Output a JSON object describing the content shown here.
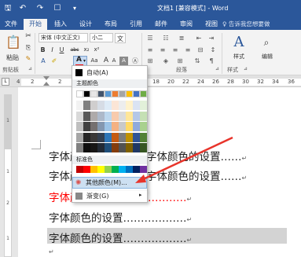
{
  "title_bar": {
    "doc_title": "文档1 [兼容模式] - Word",
    "qa_icons": [
      "save-icon",
      "undo-icon",
      "redo-icon",
      "touch-icon",
      "customize-icon"
    ],
    "window_buttons": [
      "ribbon-options-icon",
      "minimize-icon",
      "restore-icon",
      "close-icon"
    ],
    "qa_glyphs": [
      "🖫",
      "↶",
      "↷",
      "☐",
      "▾"
    ],
    "win_glyphs": [
      "⊡",
      "—",
      "❐",
      "✕"
    ]
  },
  "tabs": [
    {
      "label": "文件"
    },
    {
      "label": "开始",
      "active": true
    },
    {
      "label": "插入"
    },
    {
      "label": "设计"
    },
    {
      "label": "布局"
    },
    {
      "label": "引用"
    },
    {
      "label": "邮件"
    },
    {
      "label": "审阅"
    },
    {
      "label": "视图"
    }
  ],
  "tell_me": "♀ 告诉我您想要做",
  "ribbon": {
    "paste_label": "粘贴",
    "clipboard_label": "剪贴板",
    "font_name": "宋体 (中文正文)",
    "font_size": "小二",
    "wen_btn": "文",
    "bold": "B",
    "italic": "I",
    "underline": "U",
    "strike": "abc",
    "sub": "x₂",
    "sup": "x²",
    "font_color_btn": "A",
    "aa_btn": "Aa",
    "grow": "A",
    "shrink": "A",
    "clear_btn": "A",
    "style_label": "样式",
    "edit_label": "编辑",
    "paragraph_label": "段落",
    "styles_group_label": "样式",
    "corner_mark": "⊿"
  },
  "ruler": {
    "ticks": [
      "4",
      "2",
      "2",
      "18",
      "20",
      "22",
      "24",
      "26",
      "28",
      "30",
      "32",
      "34",
      "36"
    ],
    "vticks": [
      "1",
      "1",
      "2",
      "1"
    ]
  },
  "document": {
    "lines": [
      {
        "text": "字体颜色的设置……",
        "color": "#222222"
      },
      {
        "text": "字体颜色的设置……",
        "color": "#222222"
      },
      {
        "text": "字体颜色的设置………………",
        "color": "#ff0000"
      },
      {
        "text": "字体颜色的设置………………",
        "color": "#222222"
      },
      {
        "text": "字体颜色的设置………………",
        "color": "#222222",
        "highlight": "#d3d3d3"
      }
    ],
    "line1_right": "字体颜色的设置……",
    "line2_right": "字体颜色的设置……",
    "para_mark": "↵"
  },
  "color_dropdown": {
    "auto_label": "自动(A)",
    "theme_label": "主题颜色",
    "standard_label": "标准色",
    "more_colors_label": "其他颜色(M)...",
    "gradient_label": "渐变(G)",
    "theme_top_row": [
      "#ffffff",
      "#000000",
      "#e7e6e6",
      "#44546a",
      "#5b9bd5",
      "#ed7d31",
      "#a5a5a5",
      "#ffc000",
      "#4472c4",
      "#70ad47"
    ],
    "theme_columns": [
      [
        "#f2f2f2",
        "#d9d9d9",
        "#bfbfbf",
        "#a6a6a6",
        "#808080"
      ],
      [
        "#808080",
        "#595959",
        "#404040",
        "#262626",
        "#0d0d0d"
      ],
      [
        "#d0cece",
        "#aeaaaa",
        "#757070",
        "#3a3838",
        "#171616"
      ],
      [
        "#d6dce5",
        "#adb9ca",
        "#8497b0",
        "#333f50",
        "#222a35"
      ],
      [
        "#deebf7",
        "#bdd7ee",
        "#9dc3e6",
        "#2e75b6",
        "#1f4e79"
      ],
      [
        "#fbe5d6",
        "#f8cbad",
        "#f4b183",
        "#c55a11",
        "#843c0c"
      ],
      [
        "#ededed",
        "#dbdbdb",
        "#c9c9c9",
        "#7b7b7b",
        "#525252"
      ],
      [
        "#fff2cc",
        "#ffe699",
        "#ffd966",
        "#bf9000",
        "#7f6000"
      ],
      [
        "#dae3f3",
        "#b4c7e7",
        "#8faadc",
        "#2f5597",
        "#203864"
      ],
      [
        "#e2f0d9",
        "#c5e0b4",
        "#a9d18e",
        "#538135",
        "#375623"
      ]
    ],
    "standard_colors": [
      "#c00000",
      "#ff0000",
      "#ffc000",
      "#ffff00",
      "#92d050",
      "#00b050",
      "#00b0f0",
      "#0070c0",
      "#002060",
      "#7030a0"
    ]
  },
  "accent": "#2b579a",
  "arrow_color": "#e8342b"
}
